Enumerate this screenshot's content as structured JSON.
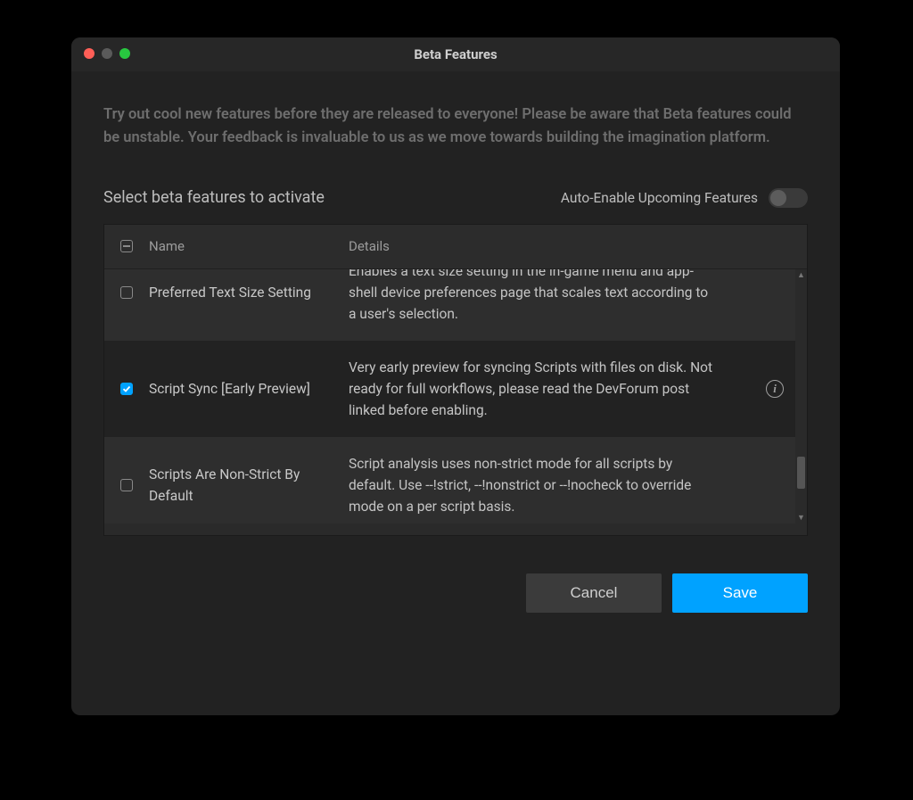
{
  "window_title": "Beta Features",
  "intro": "Try out cool new features before they are released to everyone! Please be aware that Beta features could be unstable. Your feedback is invaluable to us as we move towards building the imagination platform.",
  "subheader": "Select beta features to activate",
  "auto_enable": {
    "label": "Auto-Enable Upcoming Features",
    "on": false
  },
  "columns": {
    "name": "Name",
    "details": "Details"
  },
  "rows": [
    {
      "checked": false,
      "name": "Preferred Text Size Setting",
      "details": "Enables a text size setting in the in-game menu and app-shell device preferences page that scales text according to a user's selection.",
      "has_info": false,
      "alt": true
    },
    {
      "checked": true,
      "name": "Script Sync [Early Preview]",
      "details": "Very early preview for syncing Scripts with files on disk. Not ready for full workflows, please read the DevForum post linked before enabling.",
      "has_info": true,
      "alt": false
    },
    {
      "checked": false,
      "name": "Scripts Are Non-Strict By Default",
      "details": "Script analysis uses non-strict mode for all scripts by default. Use --!strict, --!nonstrict or --!nocheck to override mode on a per script basis.",
      "has_info": false,
      "alt": true
    }
  ],
  "buttons": {
    "cancel": "Cancel",
    "save": "Save"
  }
}
